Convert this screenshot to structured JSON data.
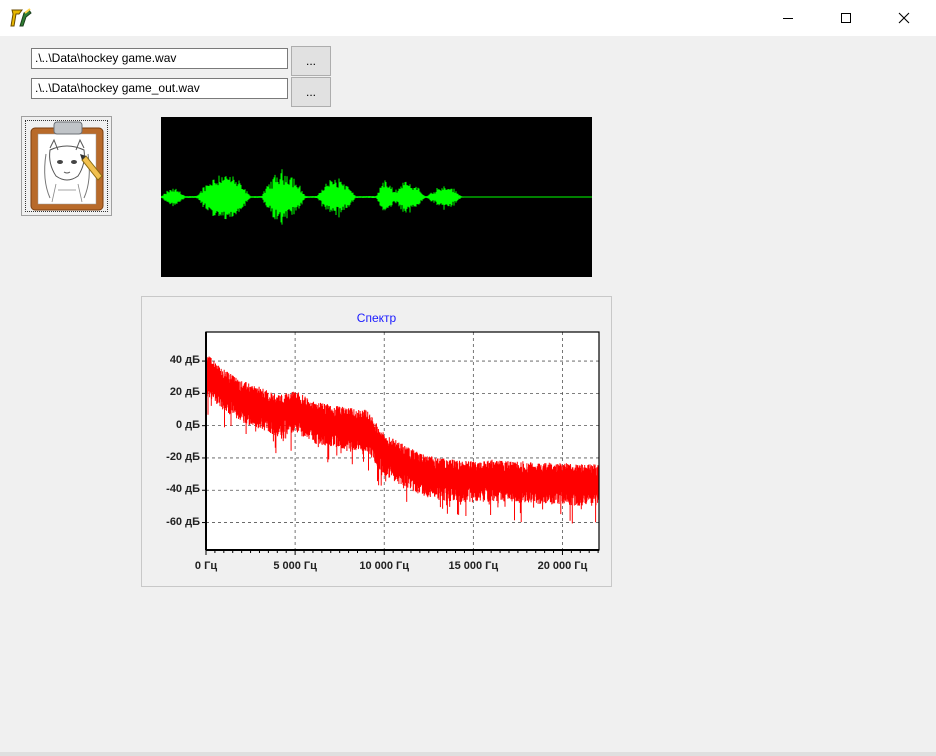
{
  "window": {
    "icon": "app-logo-icon",
    "controls": {
      "minimize": "minimize-icon",
      "maximize": "maximize-icon",
      "close": "close-icon"
    }
  },
  "files": {
    "input_path": ".\\..\\Data\\hockey game.wav",
    "output_path": ".\\..\\Data\\hockey game_out.wav",
    "browse_label": "..."
  },
  "image_button": {
    "icon": "clipboard-sketch-icon"
  },
  "waveform": {
    "background": "#000000",
    "color": "#00ff00"
  },
  "chart_data": {
    "type": "line",
    "title": "Спектр",
    "title_color": "#1a1aff",
    "series_color": "#ff0000",
    "xlabel": "",
    "ylabel": "",
    "xlim": [
      0,
      22050
    ],
    "ylim": [
      -77,
      58
    ],
    "xticks": [
      "0 Гц",
      "5 000 Гц",
      "10 000 Гц",
      "15 000 Гц",
      "20 000 Гц"
    ],
    "yticks": [
      "40 дБ",
      "20 дБ",
      "0 дБ",
      "-20 дБ",
      "-40 дБ",
      "-60 дБ"
    ],
    "grid": true,
    "series": [
      {
        "x": [
          0,
          1000,
          2000,
          3000,
          4000,
          5000,
          6000,
          7000,
          8000,
          9000,
          10000,
          11000,
          12000,
          13000,
          14000,
          15000,
          16000,
          17000,
          18000,
          19000,
          20000,
          21000,
          22050
        ],
        "values": [
          35,
          25,
          18,
          14,
          9,
          12,
          5,
          3,
          1,
          0,
          -15,
          -21,
          -27,
          -30,
          -31,
          -32,
          -31,
          -32,
          -32,
          -33,
          -33,
          -34,
          -34
        ]
      }
    ]
  }
}
